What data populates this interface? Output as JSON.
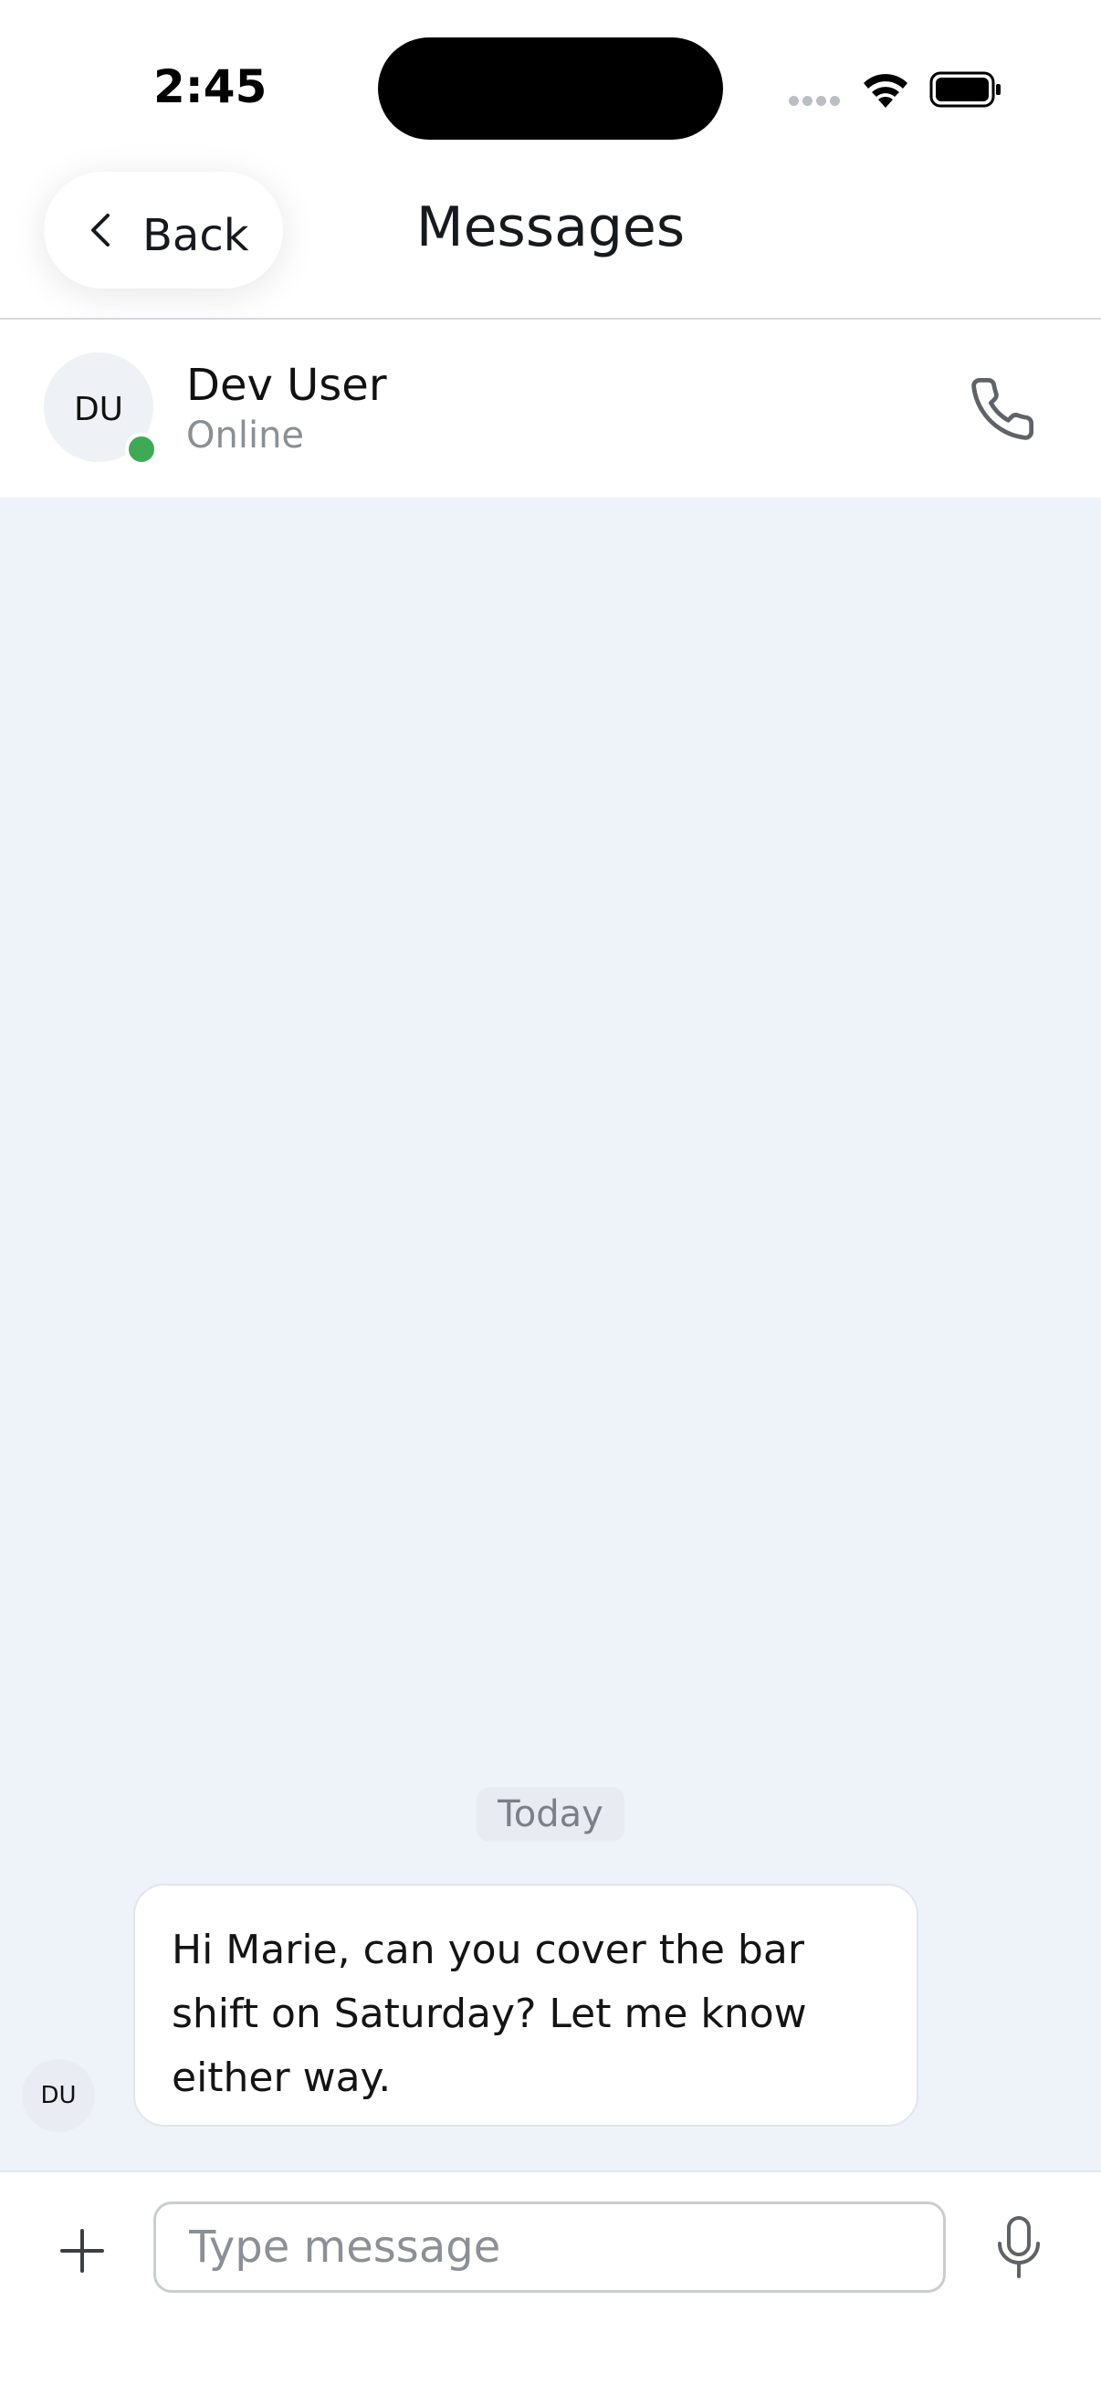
{
  "status_bar": {
    "time": "2:45"
  },
  "nav": {
    "back_label": "Back",
    "title": "Messages"
  },
  "contact": {
    "initials": "DU",
    "name": "Dev User",
    "status": "Online"
  },
  "chat": {
    "date_separator": "Today",
    "messages": [
      {
        "sender_initials": "DU",
        "text": "Hi Marie, can you cover the bar shift on Saturday? Let me know either way."
      }
    ]
  },
  "composer": {
    "placeholder": "Type message",
    "value": ""
  },
  "colors": {
    "online": "#3faa55",
    "chat_background": "#eef2f9"
  },
  "icons": [
    "chevron-left-icon",
    "phone-icon",
    "plus-icon",
    "microphone-icon",
    "wifi-icon",
    "battery-icon",
    "signal-icon"
  ]
}
